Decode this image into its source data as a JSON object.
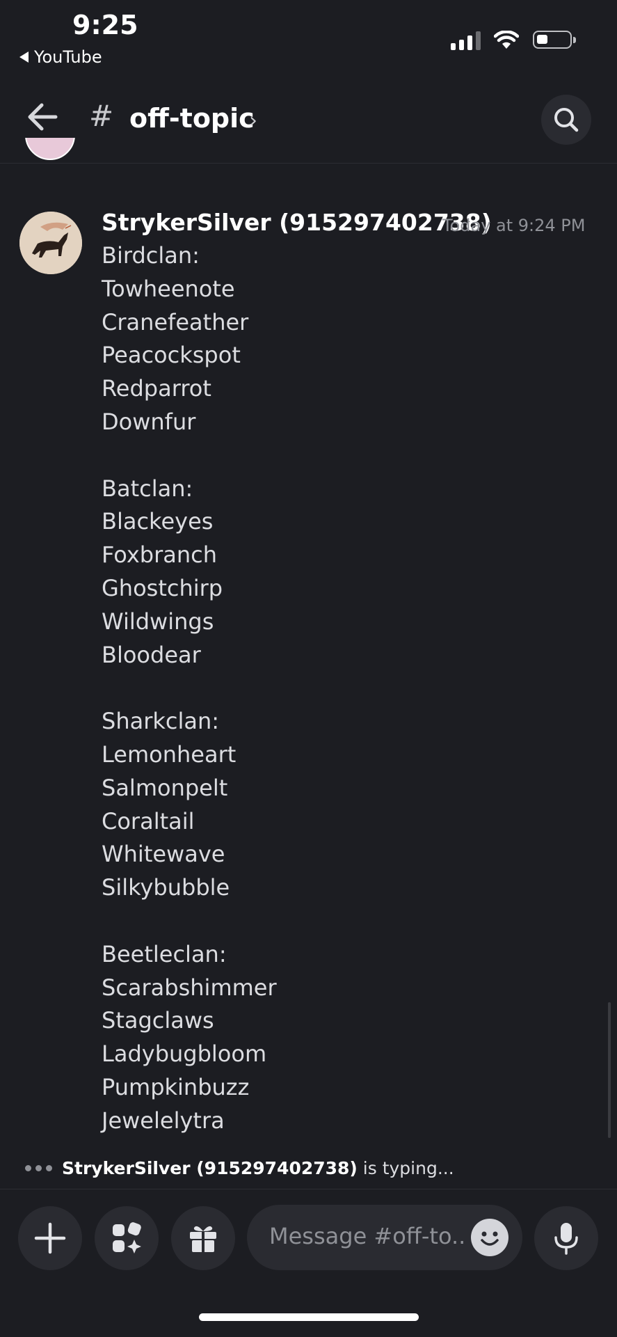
{
  "status_bar": {
    "time": "9:25",
    "back_app": "YouTube",
    "signal_bars": 3,
    "battery_level": 0.3
  },
  "header": {
    "hash": "#",
    "channel_name": "off-topic",
    "chevron": "›",
    "back_icon": "arrow-left-icon",
    "search_icon": "search-icon"
  },
  "message": {
    "author": "StrykerSilver (915297402738)",
    "timestamp": "Today at 9:24 PM",
    "lines": [
      "Birdclan:",
      "Towheenote",
      "Cranefeather",
      "Peacockspot",
      "Redparrot",
      "Downfur",
      "",
      "Batclan:",
      "Blackeyes",
      "Foxbranch",
      "Ghostchirp",
      "Wildwings",
      "Bloodear",
      "",
      "Sharkclan:",
      "Lemonheart",
      "Salmonpelt",
      "Coraltail",
      "Whitewave",
      "Silkybubble",
      "",
      "Beetleclan:",
      "Scarabshimmer",
      "Stagclaws",
      "Ladybugbloom",
      "Pumpkinbuzz",
      "Jewelelytra"
    ]
  },
  "typing": {
    "user": "StrykerSilver (915297402738)",
    "suffix": " is typing..."
  },
  "composer": {
    "placeholder": "Message #off-to..",
    "buttons": [
      "plus-icon",
      "apps-icon",
      "gift-icon",
      "emoji-icon",
      "microphone-icon"
    ]
  },
  "colors": {
    "background": "#1c1d22",
    "surface": "#2a2b31",
    "text": "#dcdde1",
    "muted": "#8f9197"
  }
}
